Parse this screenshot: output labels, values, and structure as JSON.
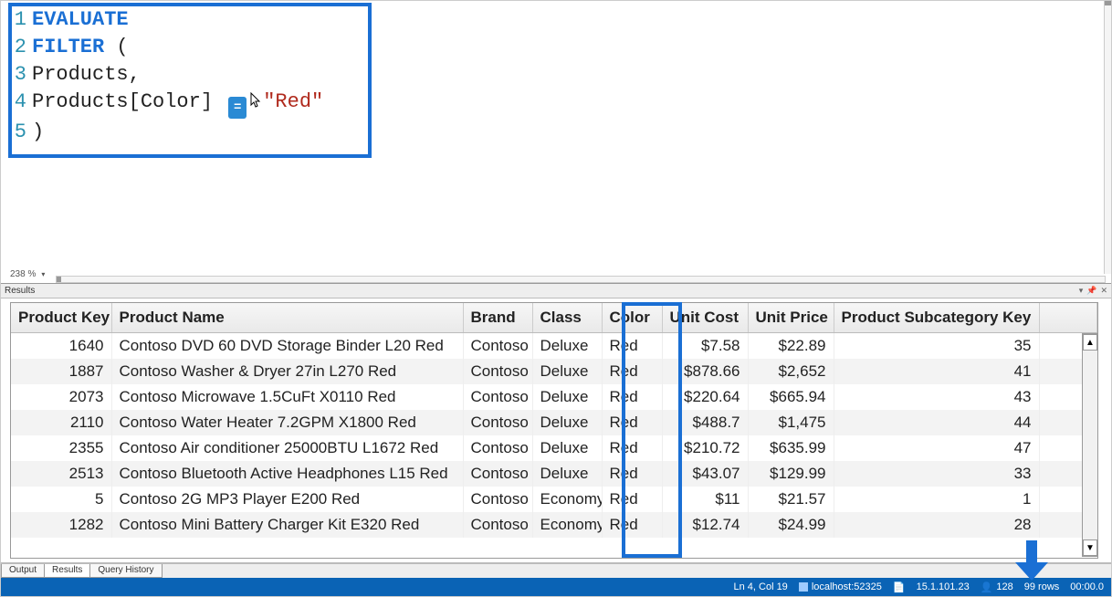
{
  "editor": {
    "zoom": "238 %",
    "lines": [
      {
        "n": "1",
        "tokens": [
          {
            "t": "EVALUATE",
            "c": "kw"
          }
        ]
      },
      {
        "n": "2",
        "tokens": [
          {
            "t": "FILTER",
            "c": "kw"
          },
          {
            "t": " (",
            "c": "plain"
          }
        ]
      },
      {
        "n": "3",
        "tokens": [
          {
            "t": "    Products,",
            "c": "plain"
          }
        ]
      },
      {
        "n": "4",
        "tokens": [
          {
            "t": "    Products[Color] ",
            "c": "plain"
          },
          {
            "t": "OP",
            "c": "op"
          },
          {
            "t": "\"Red\"",
            "c": "str"
          }
        ]
      },
      {
        "n": "5",
        "tokens": [
          {
            "t": ")",
            "c": "plain"
          }
        ]
      }
    ]
  },
  "results": {
    "title": "Results",
    "columns": [
      "Product Key",
      "Product Name",
      "Brand",
      "Class",
      "Color",
      "Unit Cost",
      "Unit Price",
      "Product Subcategory Key"
    ],
    "rows": [
      {
        "key": "1640",
        "name": "Contoso DVD 60 DVD Storage Binder L20 Red",
        "brand": "Contoso",
        "class": "Deluxe",
        "color": "Red",
        "ucost": "$7.58",
        "uprice": "$22.89",
        "subk": "35"
      },
      {
        "key": "1887",
        "name": "Contoso Washer & Dryer 27in L270 Red",
        "brand": "Contoso",
        "class": "Deluxe",
        "color": "Red",
        "ucost": "$878.66",
        "uprice": "$2,652",
        "subk": "41"
      },
      {
        "key": "2073",
        "name": "Contoso Microwave 1.5CuFt X0110 Red",
        "brand": "Contoso",
        "class": "Deluxe",
        "color": "Red",
        "ucost": "$220.64",
        "uprice": "$665.94",
        "subk": "43"
      },
      {
        "key": "2110",
        "name": "Contoso Water Heater 7.2GPM X1800 Red",
        "brand": "Contoso",
        "class": "Deluxe",
        "color": "Red",
        "ucost": "$488.7",
        "uprice": "$1,475",
        "subk": "44"
      },
      {
        "key": "2355",
        "name": "Contoso Air conditioner 25000BTU L1672 Red",
        "brand": "Contoso",
        "class": "Deluxe",
        "color": "Red",
        "ucost": "$210.72",
        "uprice": "$635.99",
        "subk": "47"
      },
      {
        "key": "2513",
        "name": "Contoso Bluetooth Active Headphones L15 Red",
        "brand": "Contoso",
        "class": "Deluxe",
        "color": "Red",
        "ucost": "$43.07",
        "uprice": "$129.99",
        "subk": "33"
      },
      {
        "key": "5",
        "name": "Contoso 2G MP3 Player E200 Red",
        "brand": "Contoso",
        "class": "Economy",
        "color": "Red",
        "ucost": "$11",
        "uprice": "$21.57",
        "subk": "1"
      },
      {
        "key": "1282",
        "name": "Contoso Mini Battery Charger Kit E320 Red",
        "brand": "Contoso",
        "class": "Economy",
        "color": "Red",
        "ucost": "$12.74",
        "uprice": "$24.99",
        "subk": "28"
      }
    ]
  },
  "tabs": {
    "output": "Output",
    "results": "Results",
    "history": "Query History"
  },
  "status": {
    "pos": "Ln 4, Col 19",
    "server": "localhost:52325",
    "ip": "15.1.101.23",
    "mem": "128",
    "rows": "99 rows",
    "time": "00:00.0"
  }
}
